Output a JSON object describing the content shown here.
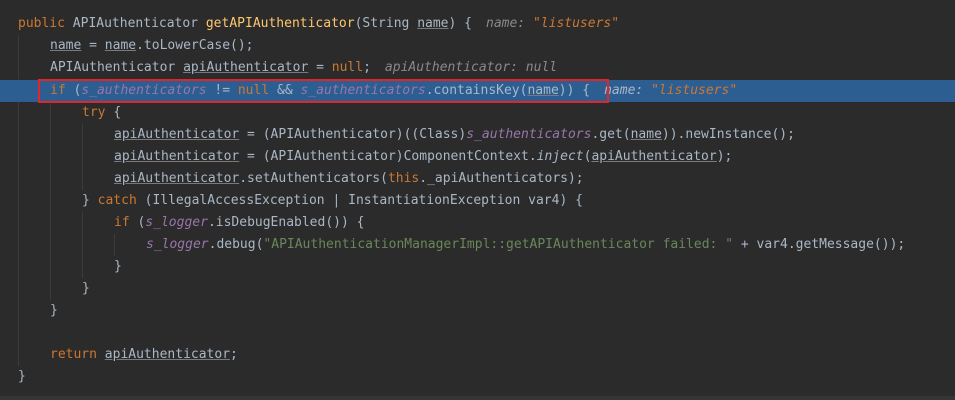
{
  "editor": {
    "lines": [
      {
        "segments": [
          [
            "kw",
            "public "
          ],
          [
            "",
            "APIAuthenticator "
          ],
          [
            "fn",
            "getAPIAuthenticator"
          ],
          [
            "",
            "(String "
          ],
          [
            "ul",
            "name"
          ],
          [
            "",
            ") {"
          ]
        ],
        "hint": [
          "name: ",
          "\"listusers\""
        ]
      },
      {
        "segments": [
          [
            "ul",
            "name"
          ],
          [
            "",
            " = "
          ],
          [
            "ul",
            "name"
          ],
          [
            "",
            ".toLowerCase();"
          ]
        ]
      },
      {
        "segments": [
          [
            "",
            "APIAuthenticator "
          ],
          [
            "ul",
            "apiAuthenticator"
          ],
          [
            "",
            " = "
          ],
          [
            "kw",
            "null"
          ],
          [
            "",
            ";"
          ]
        ],
        "hint": [
          "apiAuthenticator: null",
          ""
        ]
      },
      {
        "segments": [
          [
            "kw",
            "if "
          ],
          [
            "",
            "("
          ],
          [
            "st",
            "s_authenticators"
          ],
          [
            "",
            " != "
          ],
          [
            "kw",
            "null"
          ],
          [
            "",
            " && "
          ],
          [
            "st",
            "s_authenticators"
          ],
          [
            "",
            ".containsKey("
          ],
          [
            "ul",
            "name"
          ],
          [
            "",
            ")) {"
          ]
        ],
        "hint": [
          "name: ",
          "\"listusers\""
        ]
      },
      {
        "segments": [
          [
            "kw",
            "try "
          ],
          [
            "",
            "{"
          ]
        ]
      },
      {
        "segments": [
          [
            "ul",
            "apiAuthenticator"
          ],
          [
            "",
            " = (APIAuthenticator)((Class)"
          ],
          [
            "st",
            "s_authenticators"
          ],
          [
            "",
            ".get("
          ],
          [
            "ul",
            "name"
          ],
          [
            "",
            ")).newInstance();"
          ]
        ]
      },
      {
        "segments": [
          [
            "ul",
            "apiAuthenticator"
          ],
          [
            "",
            " = (APIAuthenticator)ComponentContext."
          ],
          [
            "it",
            "inject"
          ],
          [
            "",
            "("
          ],
          [
            "ul",
            "apiAuthenticator"
          ],
          [
            "",
            ");"
          ]
        ]
      },
      {
        "segments": [
          [
            "ul",
            "apiAuthenticator"
          ],
          [
            "",
            ".setAuthenticators("
          ],
          [
            "kw",
            "this"
          ],
          [
            "",
            "._apiAuthenticators);"
          ]
        ]
      },
      {
        "segments": [
          [
            "",
            "} "
          ],
          [
            "kw",
            "catch "
          ],
          [
            "",
            "(IllegalAccessException | InstantiationException var4) {"
          ]
        ]
      },
      {
        "segments": [
          [
            "kw",
            "if "
          ],
          [
            "",
            "("
          ],
          [
            "st",
            "s_logger"
          ],
          [
            "",
            ".isDebugEnabled()) {"
          ]
        ]
      },
      {
        "segments": [
          [
            "st",
            "s_logger"
          ],
          [
            "",
            ".debug("
          ],
          [
            "str",
            "\"APIAuthenticationManagerImpl::getAPIAuthenticator failed: \""
          ],
          [
            "",
            " + var4.getMessage());"
          ]
        ]
      },
      {
        "segments": [
          [
            "",
            "}"
          ]
        ]
      },
      {
        "segments": [
          [
            "",
            "}"
          ]
        ]
      },
      {
        "segments": [
          [
            "",
            "}"
          ]
        ]
      },
      {
        "segments": []
      },
      {
        "segments": [
          [
            "kw",
            "return "
          ],
          [
            "ul",
            "apiAuthenticator"
          ],
          [
            "",
            ";"
          ]
        ]
      },
      {
        "segments": [
          [
            "",
            "}"
          ]
        ]
      }
    ]
  }
}
